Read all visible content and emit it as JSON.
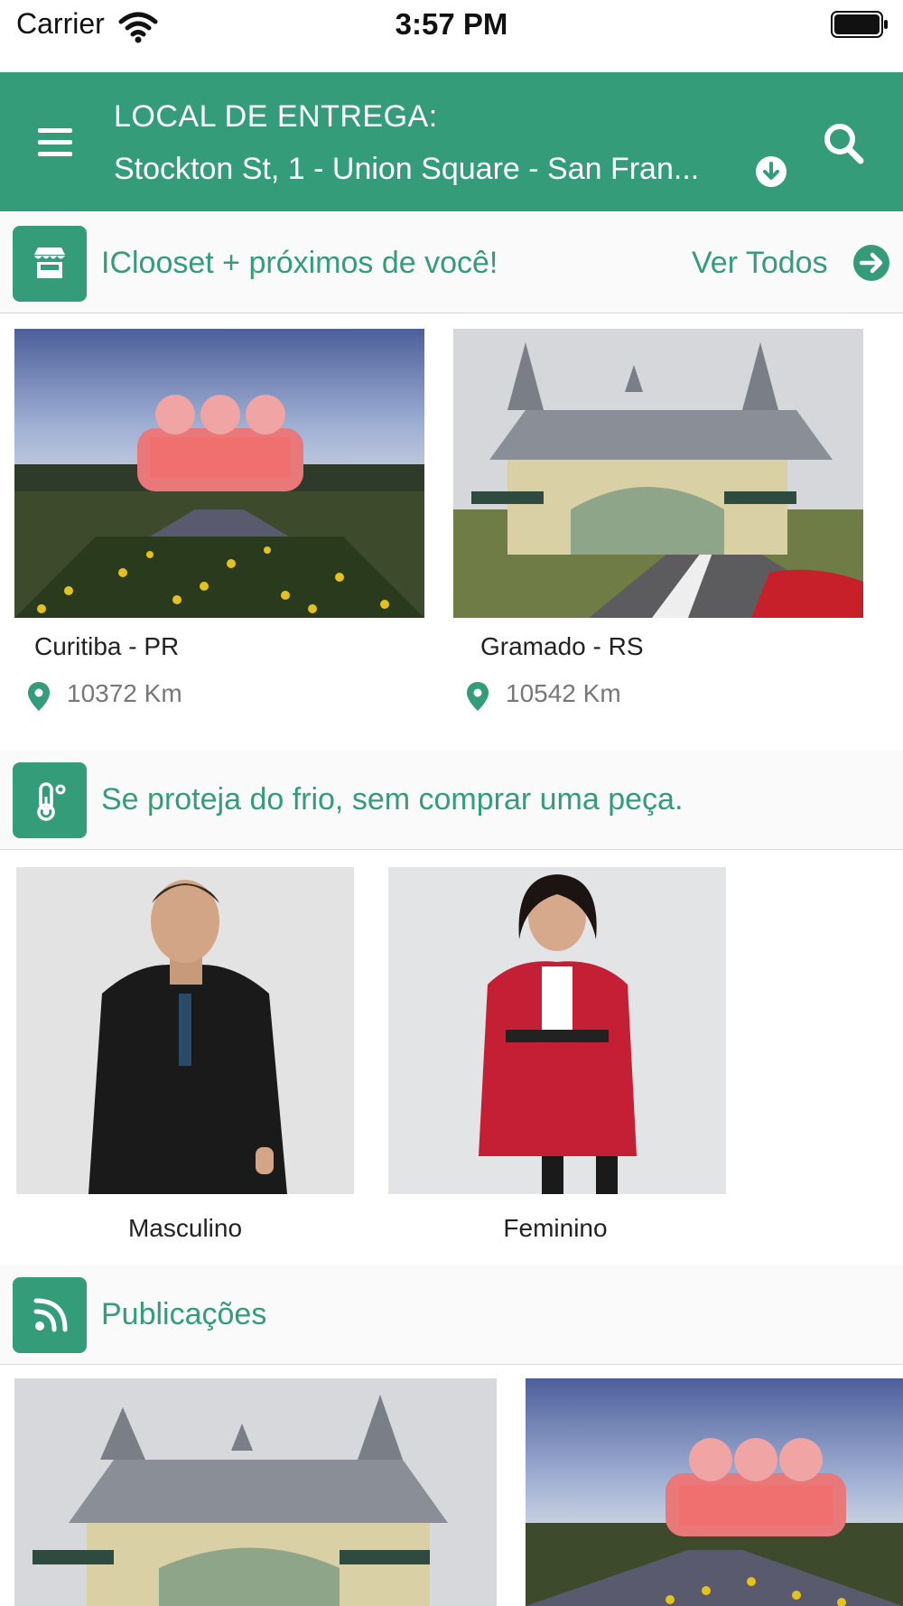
{
  "status_bar": {
    "carrier": "Carrier",
    "time": "3:57 PM"
  },
  "header": {
    "delivery_label": "LOCAL DE ENTREGA:",
    "delivery_address": "Stockton St, 1 - Union Square - San Fran...",
    "icons": {
      "menu": "menu-icon",
      "dropdown": "arrow-down-circle-icon",
      "search": "search-icon"
    }
  },
  "stores_section": {
    "title": "IClooset + próximos de você!",
    "see_all": "Ver Todos",
    "items": [
      {
        "name": "Curitiba - PR",
        "distance": "10372 Km"
      },
      {
        "name": "Gramado - RS",
        "distance": "10542 Km"
      }
    ]
  },
  "cold_section": {
    "title": "Se proteja do frio, sem comprar uma peça.",
    "items": [
      {
        "label": "Masculino"
      },
      {
        "label": "Feminino"
      }
    ]
  },
  "posts_section": {
    "title": "Publicações"
  },
  "colors": {
    "brand_green": "#359c7a",
    "background": "#ffffff",
    "section_bg": "#fafafa"
  }
}
